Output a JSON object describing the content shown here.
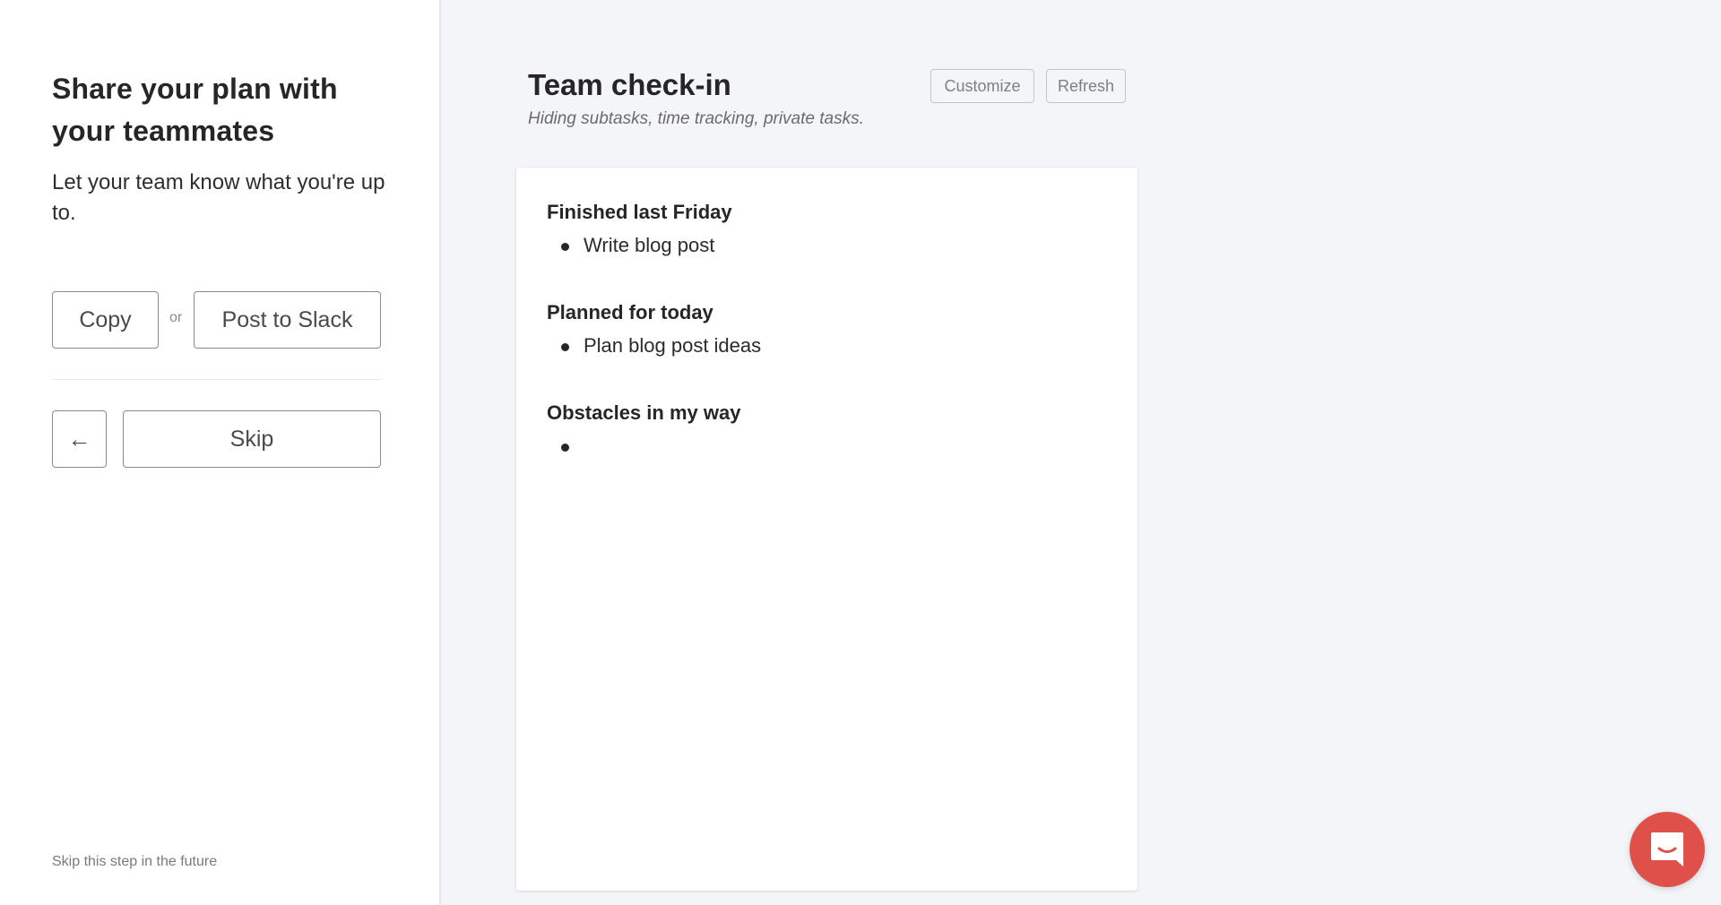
{
  "left_panel": {
    "title": "Share your plan with your teammates",
    "subtitle": "Let your team know what you're up to.",
    "copy_label": "Copy",
    "or_label": "or",
    "post_slack_label": "Post to Slack",
    "back_icon": "arrow-left-icon",
    "back_glyph": "←",
    "skip_label": "Skip",
    "skip_future_label": "Skip this step in the future"
  },
  "main": {
    "title": "Team check-in",
    "subtitle": "Hiding subtasks, time tracking, private tasks.",
    "customize_label": "Customize",
    "refresh_label": "Refresh",
    "sections": [
      {
        "heading": "Finished last Friday",
        "items": [
          "Write blog post"
        ]
      },
      {
        "heading": "Planned for today",
        "items": [
          "Plan blog post ideas"
        ]
      },
      {
        "heading": "Obstacles in my way",
        "items": [
          ""
        ]
      }
    ]
  },
  "chat_launcher": {
    "icon": "chat-bubble-icon",
    "color": "#e0504a"
  }
}
